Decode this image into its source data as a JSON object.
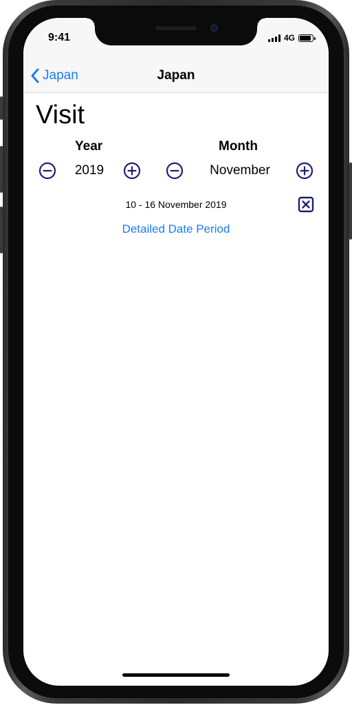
{
  "status_bar": {
    "time": "9:41",
    "network": "4G",
    "icons": [
      "signal-bars-icon",
      "battery-icon"
    ]
  },
  "nav": {
    "back_label": "Japan",
    "title": "Japan",
    "icons": [
      "chevron-left-icon"
    ]
  },
  "visit": {
    "title": "Visit",
    "year": {
      "label": "Year",
      "value": "2019",
      "icons": [
        "minus-circle-icon",
        "plus-circle-icon"
      ]
    },
    "month": {
      "label": "Month",
      "value": "November",
      "icons": [
        "minus-circle-icon",
        "plus-circle-icon"
      ]
    },
    "period": "10 - 16 November 2019",
    "clear_icon": "close-square-icon",
    "detail_link": "Detailed Date Period"
  },
  "colors": {
    "accent": "#1a7cf0",
    "stepper": "#1f1f6e",
    "bar_background": "#f7f7f7"
  }
}
